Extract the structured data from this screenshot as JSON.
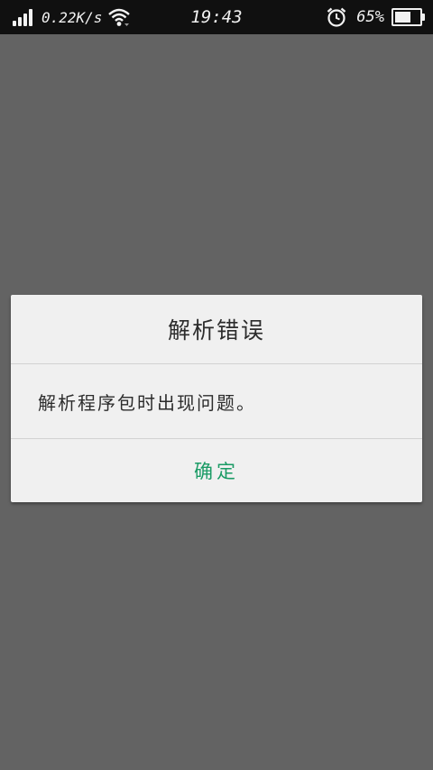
{
  "status_bar": {
    "net_speed": "0.22K/s",
    "time": "19:43",
    "battery_percent": "65%",
    "battery_level": 0.65,
    "icons": [
      "signal-icon",
      "wifi-icon",
      "alarm-icon",
      "battery-icon"
    ]
  },
  "dialog": {
    "title": "解析错误",
    "message": "解析程序包时出现问题。",
    "confirm_label": "确定"
  },
  "colors": {
    "accent": "#1a9b65",
    "scrim": "#636363",
    "dialog_bg": "#f0f0f0",
    "statusbar_bg": "#101010"
  }
}
